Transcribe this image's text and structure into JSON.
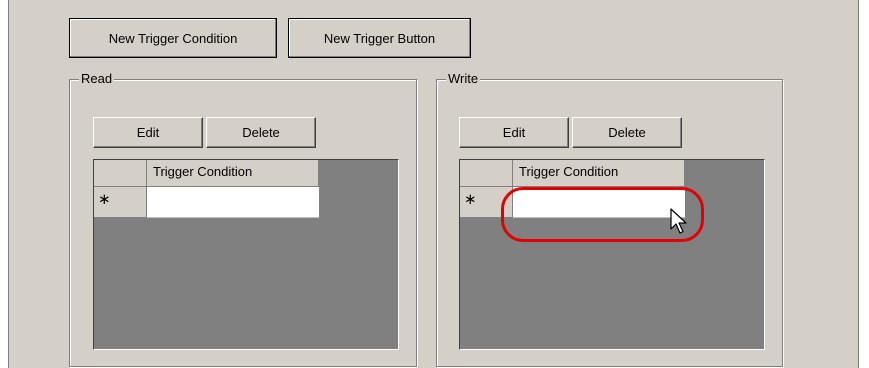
{
  "toolbar": {
    "new_trigger_condition": "New Trigger Condition",
    "new_trigger_button": "New Trigger Button"
  },
  "read_group": {
    "label": "Read",
    "edit_label": "Edit",
    "delete_label": "Delete",
    "column_header": "Trigger Condition",
    "new_row_marker": "∗",
    "new_row_value": ""
  },
  "write_group": {
    "label": "Write",
    "edit_label": "Edit",
    "delete_label": "Delete",
    "column_header": "Trigger Condition",
    "new_row_marker": "∗",
    "new_row_value": ""
  },
  "colors": {
    "dialog_bg": "#d4d0c8",
    "grid_bg": "#808080",
    "highlight": "#e00000"
  },
  "icons": [
    "arrow-cursor-icon"
  ]
}
